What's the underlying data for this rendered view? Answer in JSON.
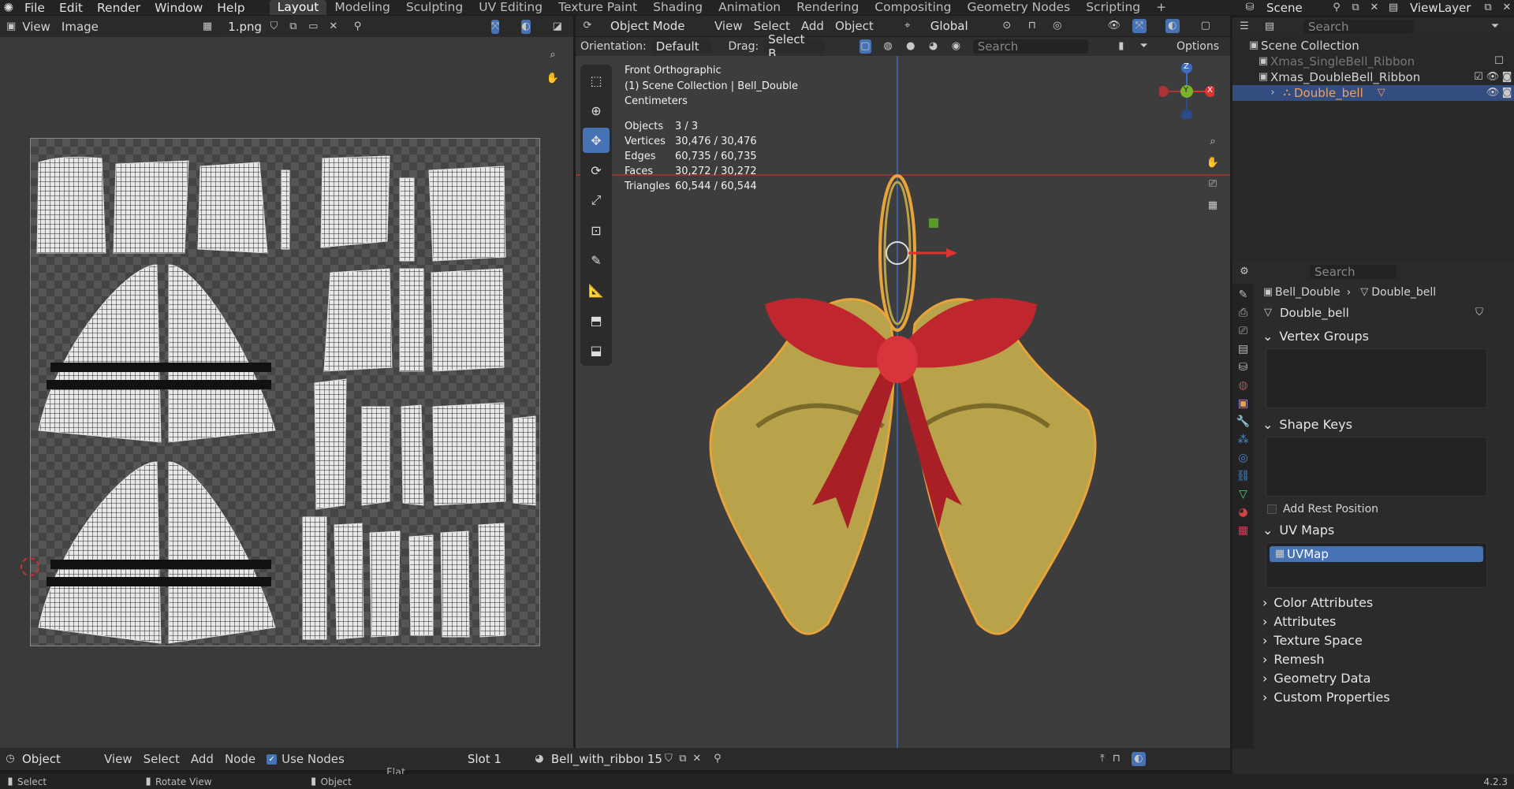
{
  "topbar": {
    "menus": [
      "File",
      "Edit",
      "Render",
      "Window",
      "Help"
    ],
    "workspaces": [
      "Layout",
      "Modeling",
      "Sculpting",
      "UV Editing",
      "Texture Paint",
      "Shading",
      "Animation",
      "Rendering",
      "Compositing",
      "Geometry Nodes",
      "Scripting",
      "+"
    ],
    "active_workspace": "Layout",
    "scene": "Scene",
    "view_layer": "ViewLayer"
  },
  "uv_editor": {
    "menus": [
      "View",
      "Image"
    ],
    "image_name": "1.png"
  },
  "viewport": {
    "mode": "Object Mode",
    "menus": [
      "View",
      "Select",
      "Add",
      "Object"
    ],
    "transform": "Global",
    "orientation_label": "Orientation:",
    "orientation_value": "Default",
    "drag_label": "Drag:",
    "drag_value": "Select B...",
    "search_placeholder": "Search",
    "options": "Options",
    "view_name": "Front Orthographic",
    "collection_info": "(1) Scene Collection | Bell_Double",
    "units": "Centimeters",
    "stats": [
      {
        "k": "Objects",
        "v": "3 / 3"
      },
      {
        "k": "Vertices",
        "v": "30,476 / 30,476"
      },
      {
        "k": "Edges",
        "v": "60,735 / 60,735"
      },
      {
        "k": "Faces",
        "v": "30,272 / 30,272"
      },
      {
        "k": "Triangles",
        "v": "60,544 / 60,544"
      }
    ],
    "gizmo": {
      "x": "X",
      "y": "Y",
      "z": "Z"
    }
  },
  "outliner": {
    "search_placeholder": "Search",
    "root": "Scene Collection",
    "items": [
      "Xmas_SingleBell_Ribbon",
      "Xmas_DoubleBell_Ribbon",
      "Double_bell"
    ]
  },
  "properties": {
    "search_placeholder": "Search",
    "breadcrumb_object": "Bell_Double",
    "breadcrumb_data": "Double_bell",
    "mesh_name": "Double_bell",
    "panels": {
      "vertex_groups": "Vertex Groups",
      "shape_keys": "Shape Keys",
      "add_rest_position": "Add Rest Position",
      "uv_maps": "UV Maps",
      "uv_map_item": "UVMap",
      "collapsed": [
        "Color Attributes",
        "Attributes",
        "Texture Space",
        "Remesh",
        "Geometry Data",
        "Custom Properties"
      ]
    }
  },
  "node_header": {
    "mode": "Object",
    "menus": [
      "View",
      "Select",
      "Add",
      "Node"
    ],
    "use_nodes": "Use Nodes",
    "slot": "Slot 1",
    "material": "Bell_with_ribbon",
    "users": "15",
    "flat": "Flat"
  },
  "statusbar": {
    "items": [
      "Select",
      "Rotate View",
      "Object"
    ],
    "version": "4.2.3"
  },
  "colors": {
    "accent": "#4772b3",
    "selection": "#e8a33a",
    "ribbon": "#c0262e",
    "gold": "#b8a24a"
  }
}
